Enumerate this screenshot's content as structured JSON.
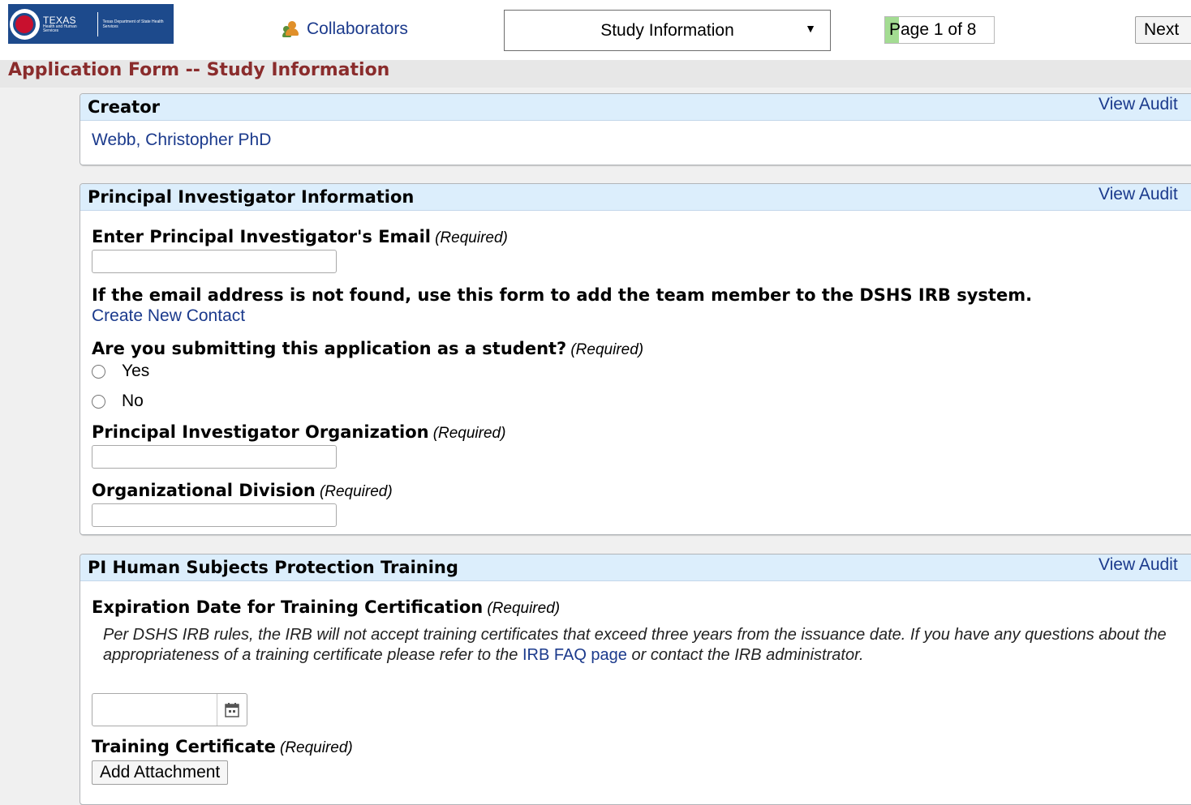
{
  "header": {
    "logo": {
      "wordmark": "TEXAS",
      "subtext": "Health and Human Services",
      "department": "Texas Department of State Health Services"
    },
    "collaborators_label": "Collaborators",
    "page_select": {
      "selected": "Study Information"
    },
    "page_indicator": "Page 1 of 8",
    "page_progress": 0.125,
    "next_label": "Next"
  },
  "form_title": "Application Form -- Study Information",
  "creator_section": {
    "title": "Creator",
    "audit_label": "View Audit",
    "creator_name": "Webb, Christopher PhD"
  },
  "pi_section": {
    "title": "Principal Investigator Information",
    "audit_label": "View Audit",
    "email_label": "Enter Principal Investigator's Email",
    "required_text": "(Required)",
    "email_value": "",
    "not_found_text": "If the email address is not found, use this form to add the team member to the DSHS IRB system.",
    "create_contact_link": "Create New Contact",
    "student_question": "Are you submitting this application as a student?",
    "student_options": [
      "Yes",
      "No"
    ],
    "org_label": "Principal Investigator Organization",
    "org_value": "",
    "division_label": "Organizational Division",
    "division_value": ""
  },
  "training_section": {
    "title": "PI Human Subjects Protection Training",
    "audit_label": "View Audit",
    "expiration_label": "Expiration Date for Training Certification",
    "required_text": "(Required)",
    "help_text_before_link": "Per DSHS IRB rules, the IRB will not accept training certificates that exceed three years from the issuance date. If you have any questions about the appropriateness of a training certificate please refer to the",
    "help_link": "IRB FAQ page",
    "help_text_after_link": "or contact the IRB administrator.",
    "date_value": "",
    "certificate_label": "Training Certificate",
    "add_attachment_label": "Add Attachment"
  }
}
